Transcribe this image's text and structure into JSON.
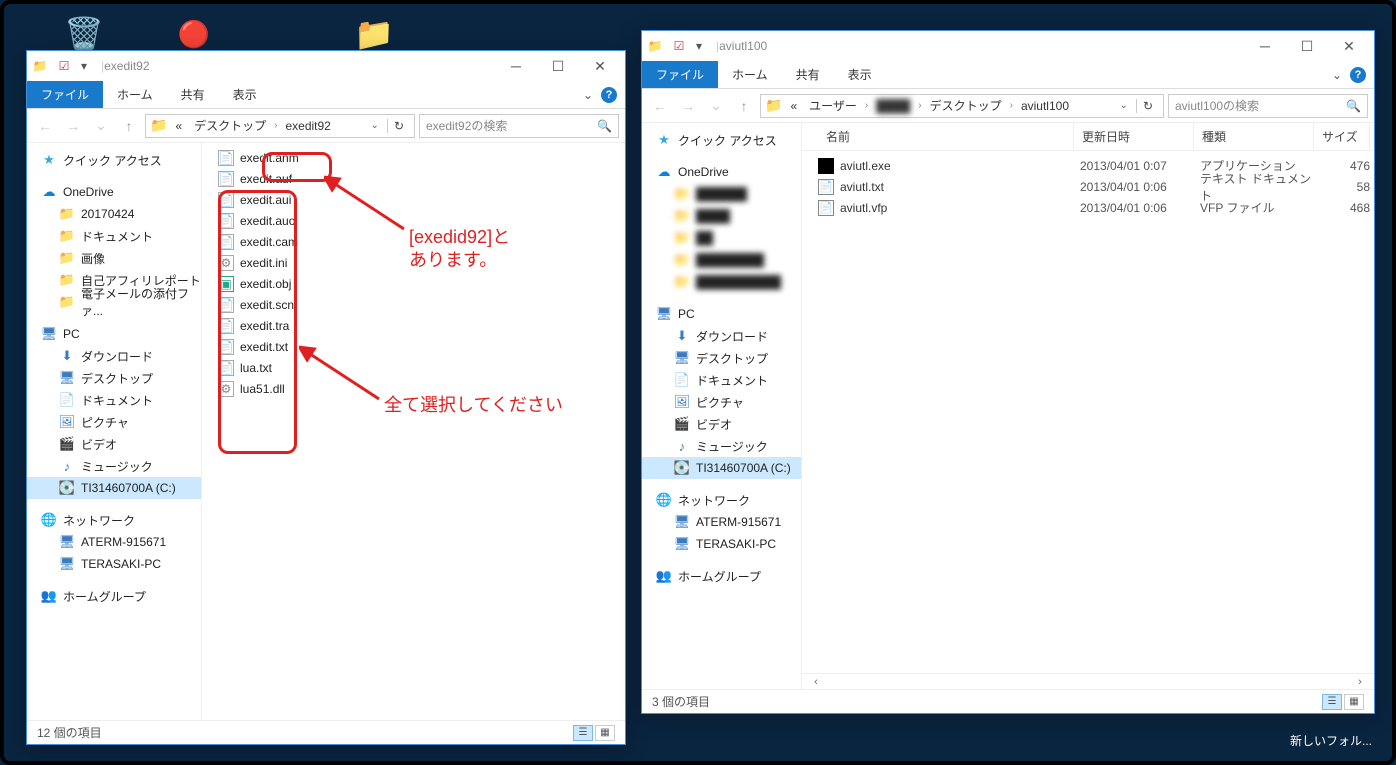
{
  "windows": {
    "left": {
      "title": "exedit92",
      "ribbon": {
        "file": "ファイル",
        "home": "ホーム",
        "share": "共有",
        "view": "表示"
      },
      "breadcrumb": [
        "«",
        "デスクトップ",
        "exedit92"
      ],
      "search_placeholder": "exedit92の検索",
      "nav": {
        "quick_access": "クイック アクセス",
        "onedrive": "OneDrive",
        "onedrive_items": [
          "20170424",
          "ドキュメント",
          "画像",
          "自己アフィリレポート",
          "電子メールの添付ファ..."
        ],
        "pc": "PC",
        "pc_items": [
          "ダウンロード",
          "デスクトップ",
          "ドキュメント",
          "ピクチャ",
          "ビデオ",
          "ミュージック",
          "TI31460700A (C:)"
        ],
        "network": "ネットワーク",
        "network_items": [
          "ATERM-915671",
          "TERASAKI-PC"
        ],
        "homegroup": "ホームグループ"
      },
      "files": [
        "exedit.anm",
        "exedit.auf",
        "exedit.aui",
        "exedit.auo",
        "exedit.cam",
        "exedit.ini",
        "exedit.obj",
        "exedit.scn",
        "exedit.tra",
        "exedit.txt",
        "lua.txt",
        "lua51.dll"
      ],
      "status": "12 個の項目"
    },
    "right": {
      "title": "aviutl100",
      "ribbon": {
        "file": "ファイル",
        "home": "ホーム",
        "share": "共有",
        "view": "表示"
      },
      "breadcrumb": [
        "«",
        "ユーザー",
        "████",
        "デスクトップ",
        "aviutl100"
      ],
      "search_placeholder": "aviutl100の検索",
      "columns": {
        "name": "名前",
        "date": "更新日時",
        "type": "種類",
        "size": "サイズ"
      },
      "nav": {
        "quick_access": "クイック アクセス",
        "onedrive": "OneDrive",
        "pc": "PC",
        "pc_items": [
          "ダウンロード",
          "デスクトップ",
          "ドキュメント",
          "ピクチャ",
          "ビデオ",
          "ミュージック",
          "TI31460700A (C:)"
        ],
        "network": "ネットワーク",
        "network_items": [
          "ATERM-915671",
          "TERASAKI-PC"
        ],
        "homegroup": "ホームグループ"
      },
      "files": [
        {
          "name": "aviutl.exe",
          "date": "2013/04/01 0:07",
          "type": "アプリケーション",
          "size": "476"
        },
        {
          "name": "aviutl.txt",
          "date": "2013/04/01 0:06",
          "type": "テキスト ドキュメント",
          "size": "58"
        },
        {
          "name": "aviutl.vfp",
          "date": "2013/04/01 0:06",
          "type": "VFP ファイル",
          "size": "468"
        }
      ],
      "status": "3 個の項目"
    }
  },
  "annotations": {
    "label1": "[exedid92]と\nあります。",
    "label2": "全て選択してください"
  },
  "desktop_footer": "新しいフォル..."
}
